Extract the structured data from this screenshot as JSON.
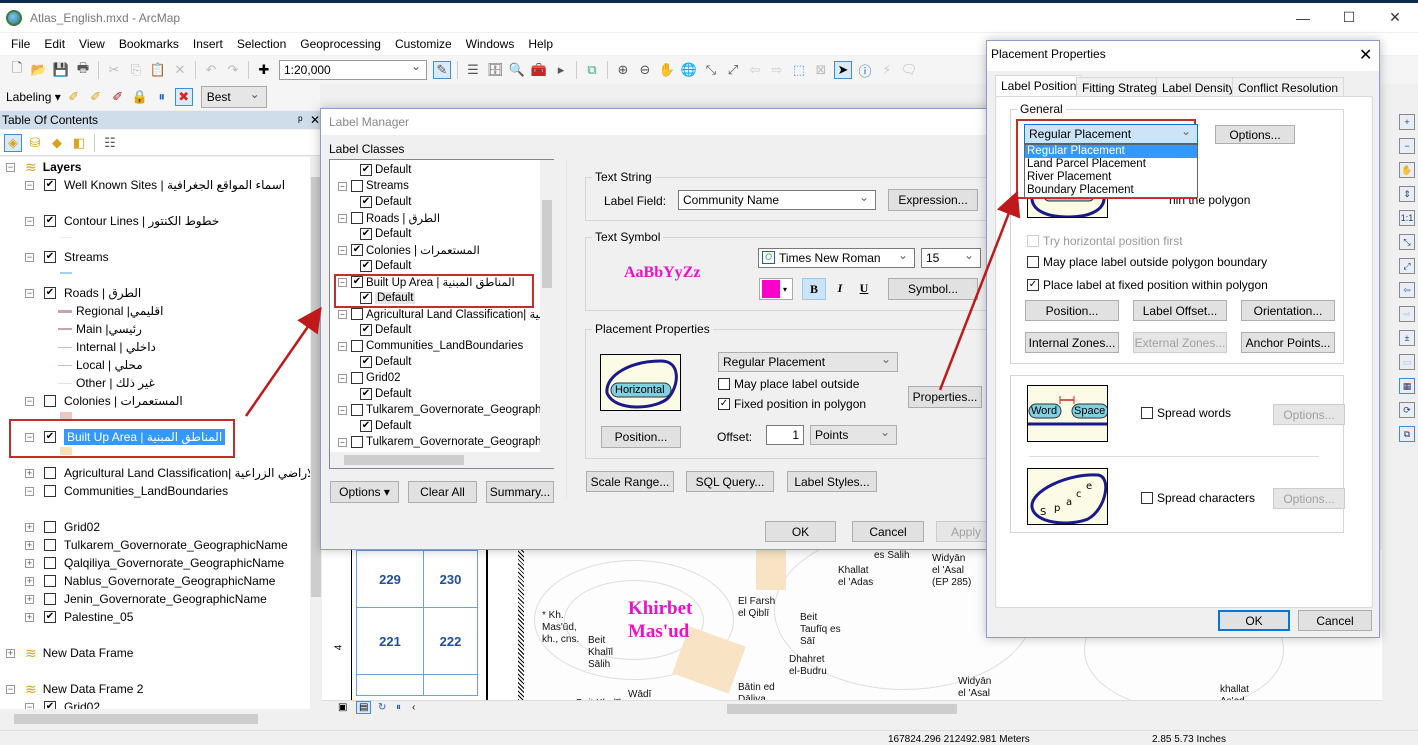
{
  "window": {
    "title": "Atlas_English.mxd - ArcMap",
    "controls": {
      "minimize": "—",
      "maximize": "☐",
      "close": "✕"
    }
  },
  "menu": [
    "File",
    "Edit",
    "View",
    "Bookmarks",
    "Insert",
    "Selection",
    "Geoprocessing",
    "Customize",
    "Windows",
    "Help"
  ],
  "toolbar": {
    "scale": "1:20,000",
    "labeling_label": "Labeling",
    "labeling_engine": "Best",
    "icons": [
      "new-document",
      "open",
      "save",
      "print",
      "cut",
      "copy",
      "paste",
      "delete",
      "undo",
      "redo",
      "add-data",
      "editor",
      "table-of-contents",
      "catalog",
      "search",
      "arctoolbox",
      "python",
      "model-builder",
      "zoom-in",
      "zoom-out",
      "pan",
      "full-extent",
      "fixed-zoom-in",
      "fixed-zoom-out",
      "back",
      "forward",
      "select-features",
      "clear-selection",
      "select-elements",
      "identify",
      "hyperlink",
      "html-popup"
    ]
  },
  "toc": {
    "header": "Table Of Contents",
    "pin": "ᵖ",
    "close": "✕",
    "root": "Layers",
    "layers": [
      {
        "name": "Well Known Sites | اسماء المواقع الجغرافية",
        "checked": true,
        "expand": "⊟"
      },
      {
        "name": "Contour Lines | خطوط الكنتور",
        "checked": true,
        "expand": "⊟"
      },
      {
        "name": "Streams",
        "checked": true,
        "expand": "⊟"
      },
      {
        "name": "Roads | الطرق",
        "checked": true,
        "expand": "⊟"
      },
      {
        "name": "Colonies | المستعمرات",
        "checked": false,
        "expand": "⊟"
      },
      {
        "name": "Built Up Area |  المناطق المبنية",
        "checked": true,
        "expand": "⊟",
        "selected": true
      },
      {
        "name": "Agricultural Land Classification| الاراضي الزراعية",
        "checked": false,
        "expand": "⊞"
      },
      {
        "name": "Communities_LandBoundaries",
        "checked": false,
        "expand": "⊟"
      },
      {
        "name": "Grid02",
        "checked": false,
        "expand": "⊞"
      },
      {
        "name": "Tulkarem_Governorate_GeographicName",
        "checked": false,
        "expand": "⊞"
      },
      {
        "name": "Qalqiliya_Governorate_GeographicName",
        "checked": false,
        "expand": "⊞"
      },
      {
        "name": "Nablus_Governorate_GeographicName",
        "checked": false,
        "expand": "⊞"
      },
      {
        "name": "Jenin_Governorate_GeographicName",
        "checked": false,
        "expand": "⊞"
      },
      {
        "name": "Palestine_05",
        "checked": true,
        "expand": "⊞"
      }
    ],
    "road_classes": [
      {
        "name": "Regional |اقليمي",
        "color": "#c9a0b8"
      },
      {
        "name": "Main |رئيسي",
        "color": "#c9a0b8"
      },
      {
        "name": "Internal | داخلي",
        "color": "#d8b8c8"
      },
      {
        "name": "Local | محلي",
        "color": "#d8b8c8"
      },
      {
        "name": "Other | غير ذلك",
        "color": "#f0dede"
      }
    ],
    "frames": [
      {
        "name": "New Data Frame",
        "expand": "⊞"
      },
      {
        "name": "New Data Frame 2",
        "expand": "⊟"
      }
    ],
    "frame2_layer": {
      "name": "Grid02",
      "checked": true
    }
  },
  "label_manager": {
    "title": "Label Manager",
    "classes_label": "Label Classes",
    "classes": [
      {
        "name": "Default",
        "checked": true,
        "child": true
      },
      {
        "name": "Streams",
        "checked": false
      },
      {
        "name": "Default",
        "checked": true,
        "child": true
      },
      {
        "name": "Roads | الطرق",
        "checked": false
      },
      {
        "name": "Default",
        "checked": true,
        "child": true
      },
      {
        "name": "Colonies | المستعمرات",
        "checked": true
      },
      {
        "name": "Default",
        "checked": true,
        "child": true
      },
      {
        "name": "Built Up Area |  المناطق المبنية",
        "checked": true
      },
      {
        "name": "Default",
        "checked": true,
        "child": true,
        "selected": true
      },
      {
        "name": "Agricultural Land Classification| عية",
        "checked": false
      },
      {
        "name": "Default",
        "checked": true,
        "child": true
      },
      {
        "name": "Communities_LandBoundaries",
        "checked": false
      },
      {
        "name": "Default",
        "checked": true,
        "child": true
      },
      {
        "name": "Grid02",
        "checked": false
      },
      {
        "name": "Default",
        "checked": true,
        "child": true
      },
      {
        "name": "Tulkarem_Governorate_Geographic",
        "checked": false
      },
      {
        "name": "Default",
        "checked": true,
        "child": true
      },
      {
        "name": "Tulkarem_Governorate_Geographic",
        "checked": false
      }
    ],
    "options_btn": "Options",
    "clear_all_btn": "Clear All",
    "summary_btn": "Summary...",
    "text_string": {
      "group": "Text String",
      "field_label": "Label Field:",
      "field_value": "Community Name",
      "expression_btn": "Expression..."
    },
    "text_symbol": {
      "group": "Text Symbol",
      "sample": "AaBbYyZz",
      "font": "Times New Roman",
      "size": "15",
      "color": "#ff00cc",
      "bold": "B",
      "italic": "I",
      "underline": "U",
      "symbol_btn": "Symbol..."
    },
    "placement": {
      "group": "Placement Properties",
      "preview_text": "Horizontal",
      "placement_value": "Regular Placement",
      "may_place_outside": "May place label outside",
      "may_place_outside_checked": false,
      "fixed_position": "Fixed position in polygon",
      "fixed_position_checked": true,
      "properties_btn": "Properties...",
      "position_btn": "Position...",
      "offset_label": "Offset:",
      "offset_value": "1",
      "offset_units": "Points"
    },
    "scale_range_btn": "Scale Range...",
    "sql_query_btn": "SQL Query...",
    "label_styles_btn": "Label Styles...",
    "ok_btn": "OK",
    "cancel_btn": "Cancel",
    "apply_btn": "Apply"
  },
  "placement_properties": {
    "title": "Placement Properties",
    "close": "✕",
    "tabs": [
      "Label Position",
      "Fitting Strategy",
      "Label Density",
      "Conflict Resolution"
    ],
    "active_tab": "Label Position",
    "general_group": "General",
    "placement_value": "Regular Placement",
    "placement_options": [
      "Regular Placement",
      "Land Parcel Placement",
      "River Placement",
      "Boundary Placement"
    ],
    "options_btn": "Options...",
    "partial_text": "hin the polygon",
    "try_horizontal": "Try horizontal position first",
    "try_horizontal_checked": false,
    "may_place_outside": "May place label outside polygon boundary",
    "may_place_outside_checked": false,
    "fixed_position": "Place label at fixed position within polygon",
    "fixed_position_checked": true,
    "buttons": [
      "Position...",
      "Label Offset...",
      "Orientation...",
      "Internal Zones...",
      "External Zones...",
      "Anchor Points..."
    ],
    "spread_words_preview": [
      "Word",
      "Space"
    ],
    "spread_words": "Spread words",
    "spread_words_checked": false,
    "spread_chars_preview": "Space",
    "spread_chars": "Spread characters",
    "spread_chars_checked": false,
    "spread_options_btn": "Options...",
    "ok_btn": "OK",
    "cancel_btn": "Cancel"
  },
  "map": {
    "grid_cells": [
      "229",
      "230",
      "221",
      "222"
    ],
    "ruler_mark": "4",
    "highlight_label": [
      "Khirbet",
      "Mas'ud"
    ],
    "highlight_color": "#ee10c8",
    "places": [
      "* Kh.\nMas'ūd,\nkh., cns.",
      "Beit\nKhalīl\nSālih",
      "Beit Khalīl\nMustafā",
      "Wādī\nZeidi",
      "El Farsh\nel Qiblī",
      "Bātin ed\nDāliya",
      "Beit\nTaufīq es\nSāī",
      "es Salih",
      "Khallat\nel 'Adas",
      "Widyān\nel 'Asal\n(EP 285)",
      "Widyān\nel 'Asal",
      "Dhahret\nel-Budru",
      "khallat\nAs'ad"
    ]
  },
  "status": {
    "coords_meters": "167824.296  212492.981 Meters",
    "coords_inches": "2.85  5.73 Inches"
  }
}
